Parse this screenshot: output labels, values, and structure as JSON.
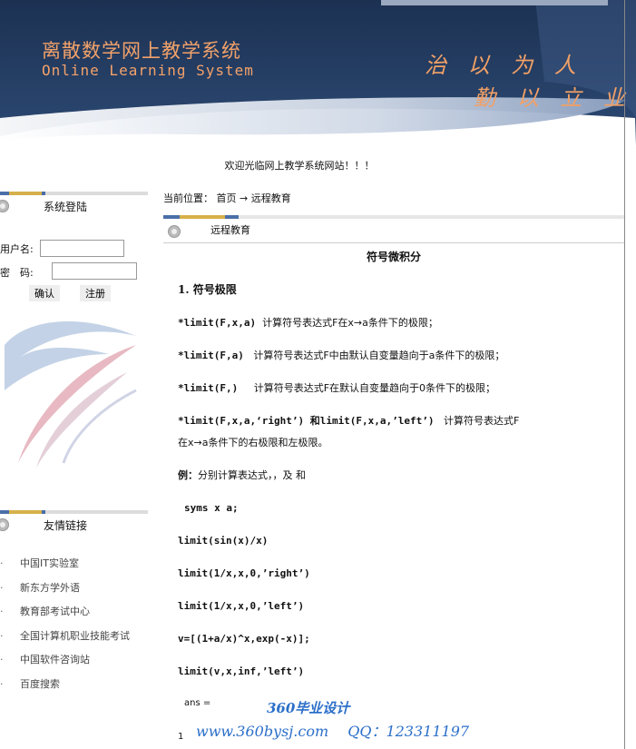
{
  "header": {
    "title_cn": "离散数学网上教学系统",
    "title_en": "Online Learning System",
    "motto_line1": "治 以 为 人",
    "motto_line2": "勤 以 立 业"
  },
  "welcome": "欢迎光临网上教学系统网站！！！",
  "login": {
    "title": "系统登陆",
    "username_label": "用户名:",
    "password_label": "密　码:",
    "username_value": "",
    "password_value": "",
    "confirm_label": "确认",
    "register_label": "注册"
  },
  "links": {
    "title": "友情链接",
    "items": [
      "中国IT实验室",
      "新东方学外语",
      "教育部考试中心",
      "全国计算机职业技能考试",
      "中国软件咨询站",
      "百度搜索"
    ],
    "bullet": "·"
  },
  "breadcrumb": {
    "prefix": "当前位置：",
    "home": "首页",
    "arrow": "→",
    "current": "远程教育"
  },
  "section_title": "远程教育",
  "article": {
    "title": "符号微积分",
    "heading1": "1. 符号极限",
    "l1_code": "*limit(F,x,a)",
    "l1_text": "计算符号表达式F在x→a条件下的极限；",
    "l2_code": "*limit(F,a)",
    "l2_text": "计算符号表达式F中由默认自变量趋向于a条件下的极限；",
    "l3_code": "*limit(F,)",
    "l3_text": "计算符号表达式F在默认自变量趋向于0条件下的极限；",
    "l4_code": "*limit(F,x,a,‘right’) 和limit(F,x,a,’left’)",
    "l4_text": "计算符号表达式F",
    "l4_text2": "在x→a条件下的右极限和左极限。",
    "example_label": "例：",
    "example_text": "分别计算表达式，，及 和",
    "code1": "syms x a;",
    "code2": "limit(sin(x)/x)",
    "code3": "limit(1/x,x,0,’right’)",
    "code4": "limit(1/x,x,0,’left’)",
    "code5": "v=[(1+a/x)^x,exp(-x)];",
    "code6": "limit(v,x,inf,’left’)",
    "ans_label": "ans =",
    "ans_value": "1"
  },
  "watermark": {
    "line1": "360毕业设计",
    "line2": "www.360bysj.com　 QQ：123311197"
  },
  "colors": {
    "banner_bg": "#223a5e",
    "title_orange": "#f3a26a",
    "accent_blue": "#4a6fa8",
    "accent_gold": "#d6b04a",
    "watermark_blue": "#2b6fc9"
  }
}
